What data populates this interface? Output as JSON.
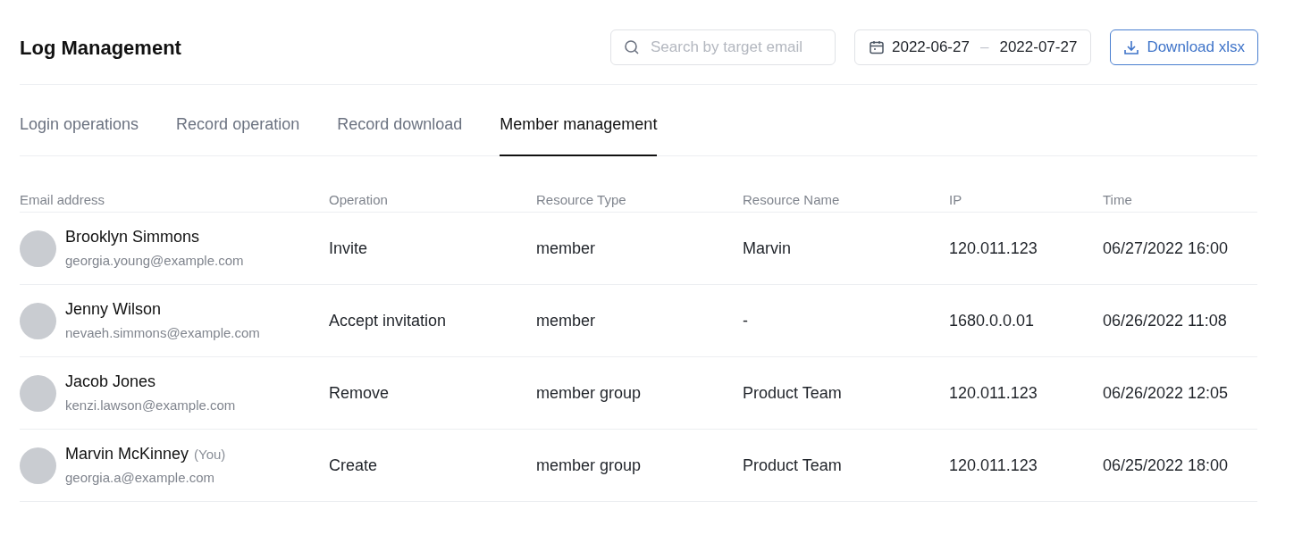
{
  "header": {
    "title": "Log Management",
    "search": {
      "placeholder": "Search by target email"
    },
    "date_range": {
      "start": "2022-06-27",
      "separator": "–",
      "end": "2022-07-27"
    },
    "download_button": "Download xlsx"
  },
  "tabs": [
    {
      "label": "Login operations",
      "selected": false
    },
    {
      "label": "Record operation",
      "selected": false
    },
    {
      "label": "Record download",
      "selected": false
    },
    {
      "label": "Member management",
      "selected": true
    }
  ],
  "table": {
    "columns": [
      "Email address",
      "Operation",
      "Resource Type",
      "Resource Name",
      "IP",
      "Time"
    ],
    "rows": [
      {
        "name": "Brooklyn Simmons",
        "tag": null,
        "email": "georgia.young@example.com",
        "operation": "Invite",
        "resource_type": "member",
        "resource_name": "Marvin",
        "ip": "120.011.123",
        "time": "06/27/2022 16:00"
      },
      {
        "name": "Jenny Wilson",
        "tag": null,
        "email": "nevaeh.simmons@example.com",
        "operation": "Accept invitation",
        "resource_type": "member",
        "resource_name": "-",
        "ip": "1680.0.0.01",
        "time": "06/26/2022 11:08"
      },
      {
        "name": "Jacob Jones",
        "tag": null,
        "email": "kenzi.lawson@example.com",
        "operation": "Remove",
        "resource_type": "member group",
        "resource_name": "Product Team",
        "ip": "120.011.123",
        "time": "06/26/2022 12:05"
      },
      {
        "name": "Marvin McKinney",
        "tag": "(You)",
        "email": "georgia.a@example.com",
        "operation": "Create",
        "resource_type": "member group",
        "resource_name": "Product Team",
        "ip": "120.011.123",
        "time": "06/25/2022 18:00"
      }
    ]
  }
}
